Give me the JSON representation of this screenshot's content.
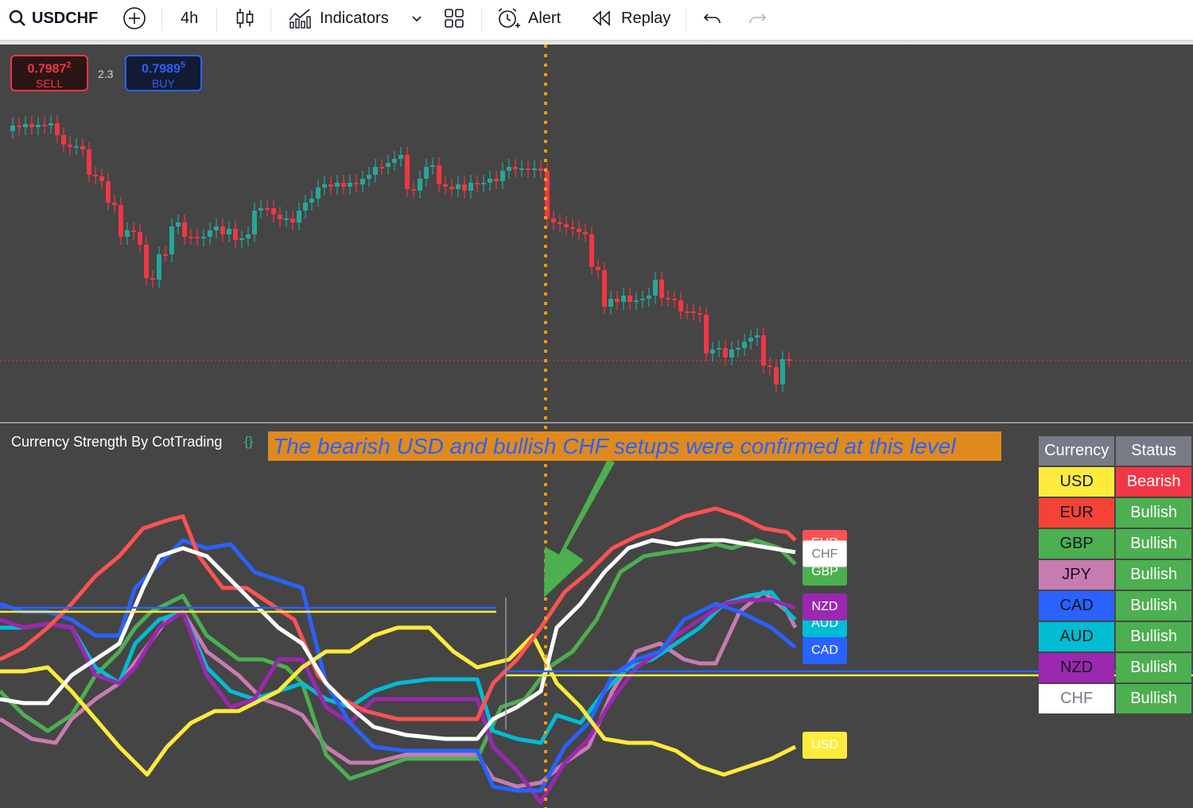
{
  "toolbar": {
    "symbol": "USDCHF",
    "interval": "4h",
    "indicators_label": "Indicators",
    "alert_label": "Alert",
    "replay_label": "Replay",
    "icons": [
      "search-icon",
      "add-symbol-icon",
      "candles-icon",
      "indicators-icon",
      "chevron-down-icon",
      "layout-icon",
      "alert-icon",
      "replay-icon",
      "undo-icon",
      "redo-icon"
    ]
  },
  "price": {
    "sell_price": "0.7987",
    "sell_price_sup": "2",
    "sell_label": "SELL",
    "spread": "2.3",
    "buy_price": "0.7989",
    "buy_price_sup": "5",
    "buy_label": "BUY"
  },
  "indicator": {
    "title": "Currency Strength By CotTrading",
    "settings_glyph": "{}",
    "annotation": "The bearish USD and bullish CHF setups were confirmed at this level"
  },
  "table": {
    "headers": [
      "Currency",
      "Status"
    ],
    "rows": [
      {
        "currency": "USD",
        "status": "Bearish",
        "cur_bg": "#ffeb3b",
        "cur_fg": "#131722",
        "st_bg": "#f23645"
      },
      {
        "currency": "EUR",
        "status": "Bullish",
        "cur_bg": "#f44336",
        "cur_fg": "#131722",
        "st_bg": "#4caf50"
      },
      {
        "currency": "GBP",
        "status": "Bullish",
        "cur_bg": "#4caf50",
        "cur_fg": "#131722",
        "st_bg": "#4caf50"
      },
      {
        "currency": "JPY",
        "status": "Bullish",
        "cur_bg": "#c77bb0",
        "cur_fg": "#131722",
        "st_bg": "#4caf50"
      },
      {
        "currency": "CAD",
        "status": "Bullish",
        "cur_bg": "#2962ff",
        "cur_fg": "#131722",
        "st_bg": "#4caf50"
      },
      {
        "currency": "AUD",
        "status": "Bullish",
        "cur_bg": "#00bcd4",
        "cur_fg": "#131722",
        "st_bg": "#4caf50"
      },
      {
        "currency": "NZD",
        "status": "Bullish",
        "cur_bg": "#9c27b0",
        "cur_fg": "#131722",
        "st_bg": "#4caf50"
      },
      {
        "currency": "CHF",
        "status": "Bullish",
        "cur_bg": "#ffffff",
        "cur_fg": "#787b86",
        "st_bg": "#4caf50"
      }
    ]
  },
  "line_tags": {
    "eur": "EUR",
    "chf": "CHF",
    "gbp": "GBP",
    "nzd": "NZD",
    "aud": "AUD",
    "cad": "CAD",
    "usd": "USD"
  },
  "colors": {
    "up": "#26a69a",
    "down": "#f23645",
    "marker": "#ff9800",
    "usd": "#ffeb3b",
    "eur": "#ff5252",
    "gbp": "#4caf50",
    "jpy": "#c77bb0",
    "cad": "#2962ff",
    "aud": "#00bcd4",
    "nzd": "#9c27b0",
    "chf": "#ffffff"
  }
}
